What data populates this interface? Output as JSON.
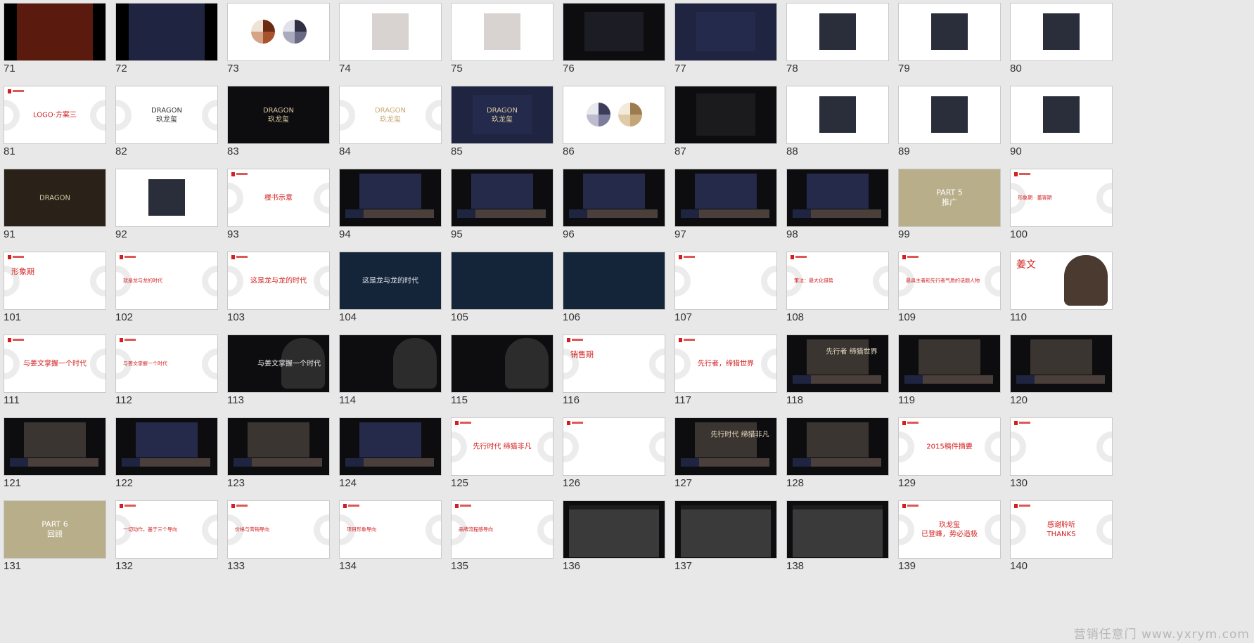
{
  "slides": [
    {
      "n": "71",
      "title": "",
      "style": "maroon-logo"
    },
    {
      "n": "72",
      "title": "",
      "style": "navy-logo"
    },
    {
      "n": "73",
      "title": "",
      "style": "pies-warm"
    },
    {
      "n": "74",
      "title": "",
      "style": "photo-light"
    },
    {
      "n": "75",
      "title": "",
      "style": "photo-light"
    },
    {
      "n": "76",
      "title": "",
      "style": "photo-dark-card"
    },
    {
      "n": "77",
      "title": "",
      "style": "navy-card"
    },
    {
      "n": "78",
      "title": "",
      "style": "object-white"
    },
    {
      "n": "79",
      "title": "",
      "style": "object-white"
    },
    {
      "n": "80",
      "title": "",
      "style": "object-white"
    },
    {
      "n": "81",
      "title": "LOGO·方案三",
      "style": "title-red"
    },
    {
      "n": "82",
      "title": "DRAGON\n玖龙玺",
      "style": "logo-white"
    },
    {
      "n": "83",
      "title": "DRAGON\n玖龙玺",
      "style": "logo-black"
    },
    {
      "n": "84",
      "title": "DRAGON\n玖龙玺",
      "style": "logo-gold"
    },
    {
      "n": "85",
      "title": "DRAGON\n玖龙玺",
      "style": "logo-navy"
    },
    {
      "n": "86",
      "title": "",
      "style": "pies-cool"
    },
    {
      "n": "87",
      "title": "",
      "style": "photo-dark"
    },
    {
      "n": "88",
      "title": "",
      "style": "object-white"
    },
    {
      "n": "89",
      "title": "",
      "style": "object-white"
    },
    {
      "n": "90",
      "title": "",
      "style": "object-white"
    },
    {
      "n": "91",
      "title": "DRAGON",
      "style": "logo-bronze"
    },
    {
      "n": "92",
      "title": "",
      "style": "object-white"
    },
    {
      "n": "93",
      "title": "楼书示意",
      "style": "title-red"
    },
    {
      "n": "94",
      "title": "",
      "style": "book-dark"
    },
    {
      "n": "95",
      "title": "",
      "style": "book-dark"
    },
    {
      "n": "96",
      "title": "",
      "style": "book-dark"
    },
    {
      "n": "97",
      "title": "",
      "style": "book-dark"
    },
    {
      "n": "98",
      "title": "",
      "style": "book-dark"
    },
    {
      "n": "99",
      "title": "PART 5\n推广",
      "style": "part-khaki"
    },
    {
      "n": "100",
      "title": "形象期 · 蓄客期",
      "style": "text-white"
    },
    {
      "n": "101",
      "title": "形象期",
      "style": "title-red-left"
    },
    {
      "n": "102",
      "title": "就是龙与龙的时代",
      "style": "text-white"
    },
    {
      "n": "103",
      "title": "这是龙与龙的时代",
      "style": "title-red"
    },
    {
      "n": "104",
      "title": "这是龙与龙的时代",
      "style": "city-night"
    },
    {
      "n": "105",
      "title": "",
      "style": "city-night"
    },
    {
      "n": "106",
      "title": "",
      "style": "city-night"
    },
    {
      "n": "107",
      "title": "",
      "style": "text-white"
    },
    {
      "n": "108",
      "title": "策法：最大化借势",
      "style": "text-white"
    },
    {
      "n": "109",
      "title": "最具主者和先行者气质的话题人物",
      "style": "text-white"
    },
    {
      "n": "110",
      "title": "姜文",
      "style": "portrait"
    },
    {
      "n": "111",
      "title": "与姜文掌握一个时代",
      "style": "title-red"
    },
    {
      "n": "112",
      "title": "与姜文掌握一个时代",
      "style": "text-white"
    },
    {
      "n": "113",
      "title": "与姜文掌握一个时代",
      "style": "portrait-dark"
    },
    {
      "n": "114",
      "title": "",
      "style": "portrait-dark"
    },
    {
      "n": "115",
      "title": "",
      "style": "portrait-dark"
    },
    {
      "n": "116",
      "title": "销售期",
      "style": "title-red-left"
    },
    {
      "n": "117",
      "title": "先行者，缔猎世界",
      "style": "title-red"
    },
    {
      "n": "118",
      "title": "先行者 缔猎世界",
      "style": "ad-dark"
    },
    {
      "n": "119",
      "title": "",
      "style": "ad-dark"
    },
    {
      "n": "120",
      "title": "",
      "style": "ad-dark"
    },
    {
      "n": "121",
      "title": "",
      "style": "ad-dark"
    },
    {
      "n": "122",
      "title": "",
      "style": "book-dark"
    },
    {
      "n": "123",
      "title": "",
      "style": "ad-dark"
    },
    {
      "n": "124",
      "title": "",
      "style": "book-dark"
    },
    {
      "n": "125",
      "title": "先行时代 缔猎非凡",
      "style": "title-red"
    },
    {
      "n": "126",
      "title": "",
      "style": "text-white"
    },
    {
      "n": "127",
      "title": "先行时代 缔猎非凡",
      "style": "ad-dark"
    },
    {
      "n": "128",
      "title": "",
      "style": "ad-dark"
    },
    {
      "n": "129",
      "title": "2015稿件摘要",
      "style": "title-red"
    },
    {
      "n": "130",
      "title": "",
      "style": "text-white"
    },
    {
      "n": "131",
      "title": "PART 6\n回顾",
      "style": "part-khaki"
    },
    {
      "n": "132",
      "title": "一切动作，基于三个导向",
      "style": "text-white"
    },
    {
      "n": "133",
      "title": "价格与营销导向",
      "style": "text-white"
    },
    {
      "n": "134",
      "title": "项目形象导向",
      "style": "text-white"
    },
    {
      "n": "135",
      "title": "品牌流程感导向",
      "style": "text-white"
    },
    {
      "n": "136",
      "title": "",
      "style": "web-dark"
    },
    {
      "n": "137",
      "title": "",
      "style": "web-dark"
    },
    {
      "n": "138",
      "title": "",
      "style": "web-dark"
    },
    {
      "n": "139",
      "title": "玖龙玺\n已登峰，势必造极",
      "style": "title-red"
    },
    {
      "n": "140",
      "title": "感谢聆听\nTHANKS",
      "style": "title-red"
    }
  ],
  "watermark": "营销任意门 www.yxrym.com",
  "colors": {
    "accent": "#d21f1f",
    "navy": "#1f2541",
    "khaki": "#b8ae8a"
  }
}
